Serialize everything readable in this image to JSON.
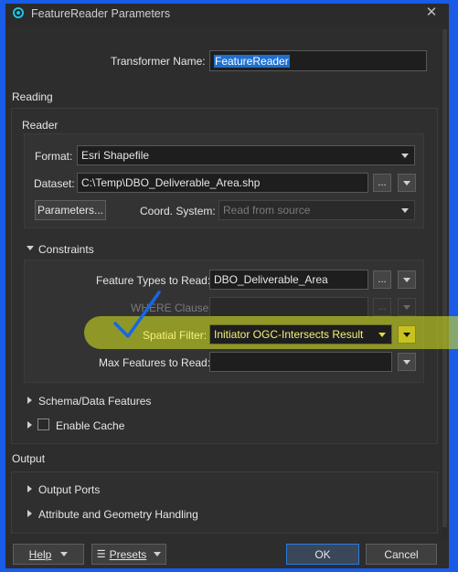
{
  "window": {
    "title": "FeatureReader Parameters"
  },
  "transformer": {
    "label": "Transformer Name:",
    "value": "FeatureReader"
  },
  "reading": {
    "section_title": "Reading",
    "reader": {
      "group_title": "Reader",
      "format_label": "Format:",
      "format_value": "Esri Shapefile",
      "dataset_label": "Dataset:",
      "dataset_value": "C:\\Temp\\DBO_Deliverable_Area.shp",
      "ellipsis": "...",
      "parameters_button": "Parameters...",
      "coord_label": "Coord. System:",
      "coord_value": "Read from source"
    },
    "constraints": {
      "title": "Constraints",
      "feature_types_label": "Feature Types to Read:",
      "feature_types_value": "DBO_Deliverable_Area",
      "where_label": "WHERE Clause:",
      "spatial_filter_label": "Spatial Filter:",
      "spatial_filter_value": "Initiator OGC-Intersects Result",
      "max_features_label": "Max Features to Read:",
      "max_features_value": ""
    },
    "schema_data": "Schema/Data Features",
    "enable_cache": "Enable Cache"
  },
  "output": {
    "section_title": "Output",
    "ports": "Output Ports",
    "attr_geom": "Attribute and Geometry Handling"
  },
  "footer": {
    "help": "Help",
    "presets": "Presets",
    "ok": "OK",
    "cancel": "Cancel"
  },
  "colors": {
    "annotation_check": "#1667e6",
    "highlight": "#cddc1e",
    "selection": "#1e6fcf"
  }
}
